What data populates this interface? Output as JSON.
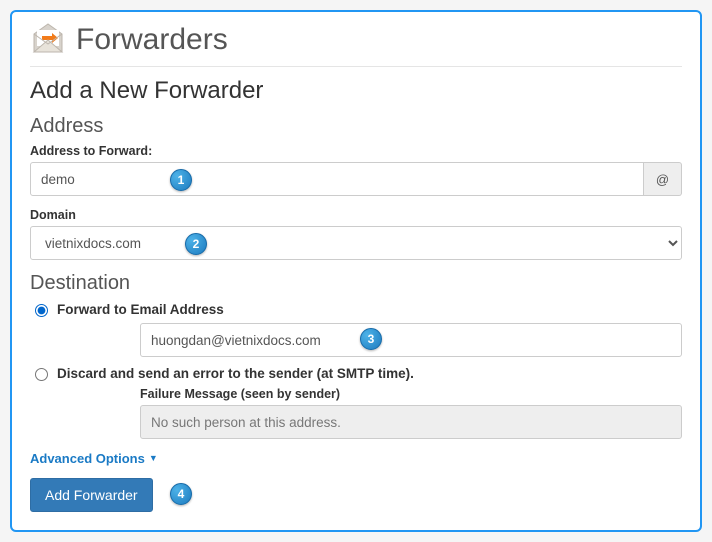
{
  "header": {
    "title": "Forwarders"
  },
  "page": {
    "subtitle": "Add a New Forwarder"
  },
  "address": {
    "heading": "Address",
    "forward_label": "Address to Forward:",
    "forward_value": "demo",
    "at": "@",
    "domain_label": "Domain",
    "domain_value": "vietnixdocs.com"
  },
  "destination": {
    "heading": "Destination",
    "forward_radio_label": "Forward to Email Address",
    "forward_email_value": "huongdan@vietnixdocs.com",
    "discard_radio_label": "Discard and send an error to the sender (at SMTP time).",
    "failure_label": "Failure Message (seen by sender)",
    "failure_value": "No such person at this address."
  },
  "advanced": {
    "label": "Advanced Options"
  },
  "submit": {
    "label": "Add Forwarder"
  },
  "markers": {
    "m1": "1",
    "m2": "2",
    "m3": "3",
    "m4": "4"
  }
}
